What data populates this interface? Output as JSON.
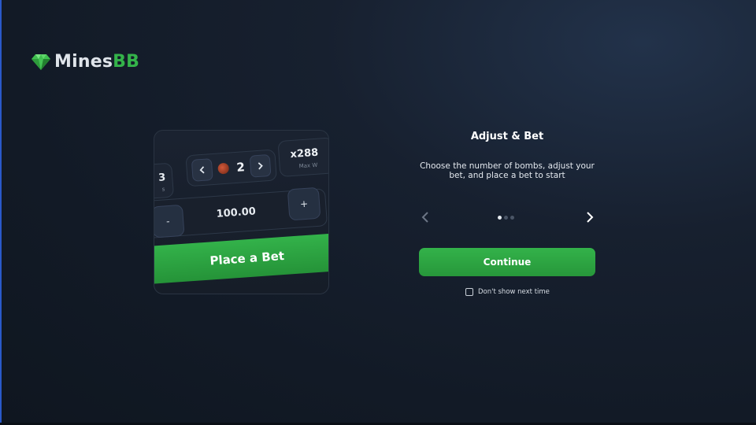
{
  "brand": {
    "name_main": "Mines",
    "name_accent": "BB",
    "icon": "gem-icon",
    "accent_color": "#34b34a"
  },
  "preview": {
    "left_value": "3",
    "left_caption": "s",
    "stepper_prev_icon": "chevron-left-icon",
    "stepper_next_icon": "chevron-right-icon",
    "bomb_icon": "bomb-icon",
    "bomb_count": "2",
    "multiplier": "x288",
    "multiplier_caption": "Max W",
    "minus_label": "-",
    "plus_label": "+",
    "amount": "100.00",
    "bet_label": "Place a Bet"
  },
  "onboarding": {
    "title": "Adjust & Bet",
    "description": "Choose the number of bombs, adjust your bet, and place a bet to start",
    "prev_icon": "chevron-left-icon",
    "next_icon": "chevron-right-icon",
    "page_count": 3,
    "current_page": 1,
    "continue_label": "Continue",
    "dont_show_label": "Don't show next time",
    "dont_show_checked": false,
    "button_color": "#2faa45"
  }
}
